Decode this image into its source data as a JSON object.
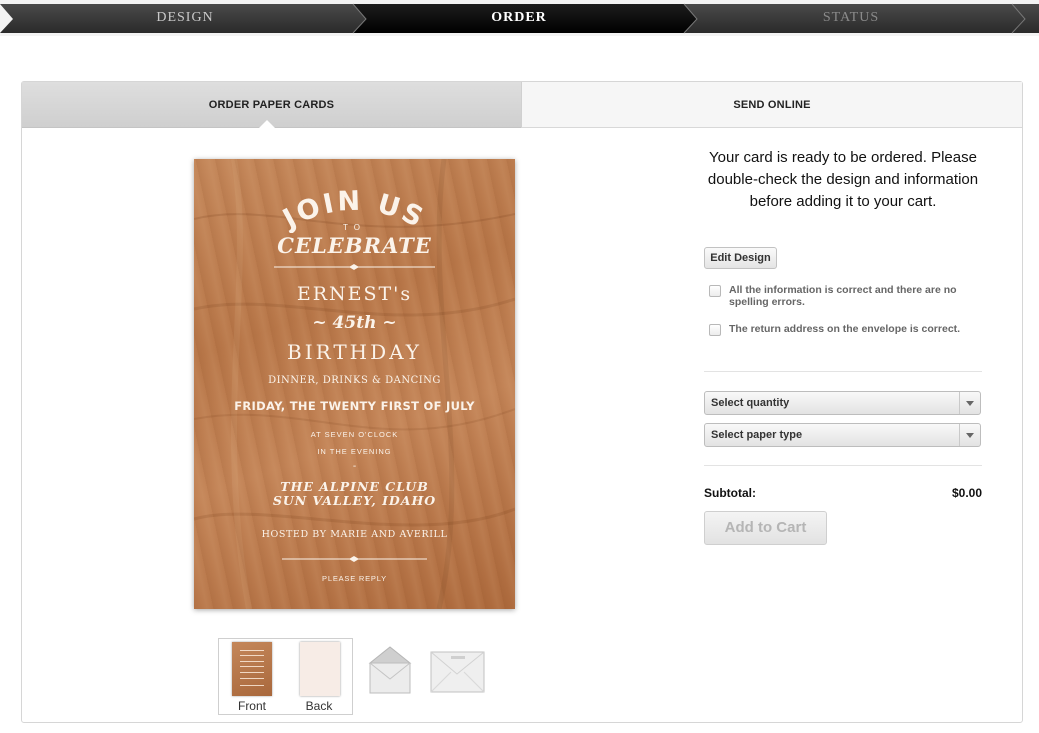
{
  "steps": {
    "design": "DESIGN",
    "order": "ORDER",
    "status": "STATUS"
  },
  "tabs": {
    "paper": "ORDER PAPER CARDS",
    "online": "SEND ONLINE"
  },
  "card": {
    "join": "JOIN US",
    "to": "TO",
    "celebrate": "CELEBRATE",
    "name": "ERNEST's",
    "age": "~ 45th ~",
    "birthday": "BIRTHDAY",
    "dinner": "DINNER, DRINKS & DANCING",
    "date": "FRIDAY, THE TWENTY FIRST OF JULY",
    "time_line1": "AT SEVEN O'CLOCK",
    "time_line2": "IN THE EVENING",
    "dash": "-",
    "venue_line1": "THE ALPINE CLUB",
    "venue_line2": "SUN VALLEY, IDAHO",
    "host": "HOSTED BY MARIE AND AVERILL",
    "reply": "PLEASE REPLY"
  },
  "thumbnails": {
    "front": "Front",
    "back": "Back"
  },
  "order": {
    "ready_text": "Your card is ready to be ordered. Please double-check the design and information before adding it to your cart.",
    "edit_design": "Edit Design",
    "check_info": "All the information is correct and there are no spelling errors.",
    "check_address": "The return address on the envelope is correct.",
    "quantity_placeholder": "Select quantity",
    "paper_placeholder": "Select paper type",
    "subtotal_label": "Subtotal:",
    "subtotal_value": "$0.00",
    "add_to_cart": "Add to Cart"
  },
  "colors": {
    "active_step_bg": "#111111",
    "wood": "#b87749",
    "tab_active_bg": "#d6d6d6"
  }
}
